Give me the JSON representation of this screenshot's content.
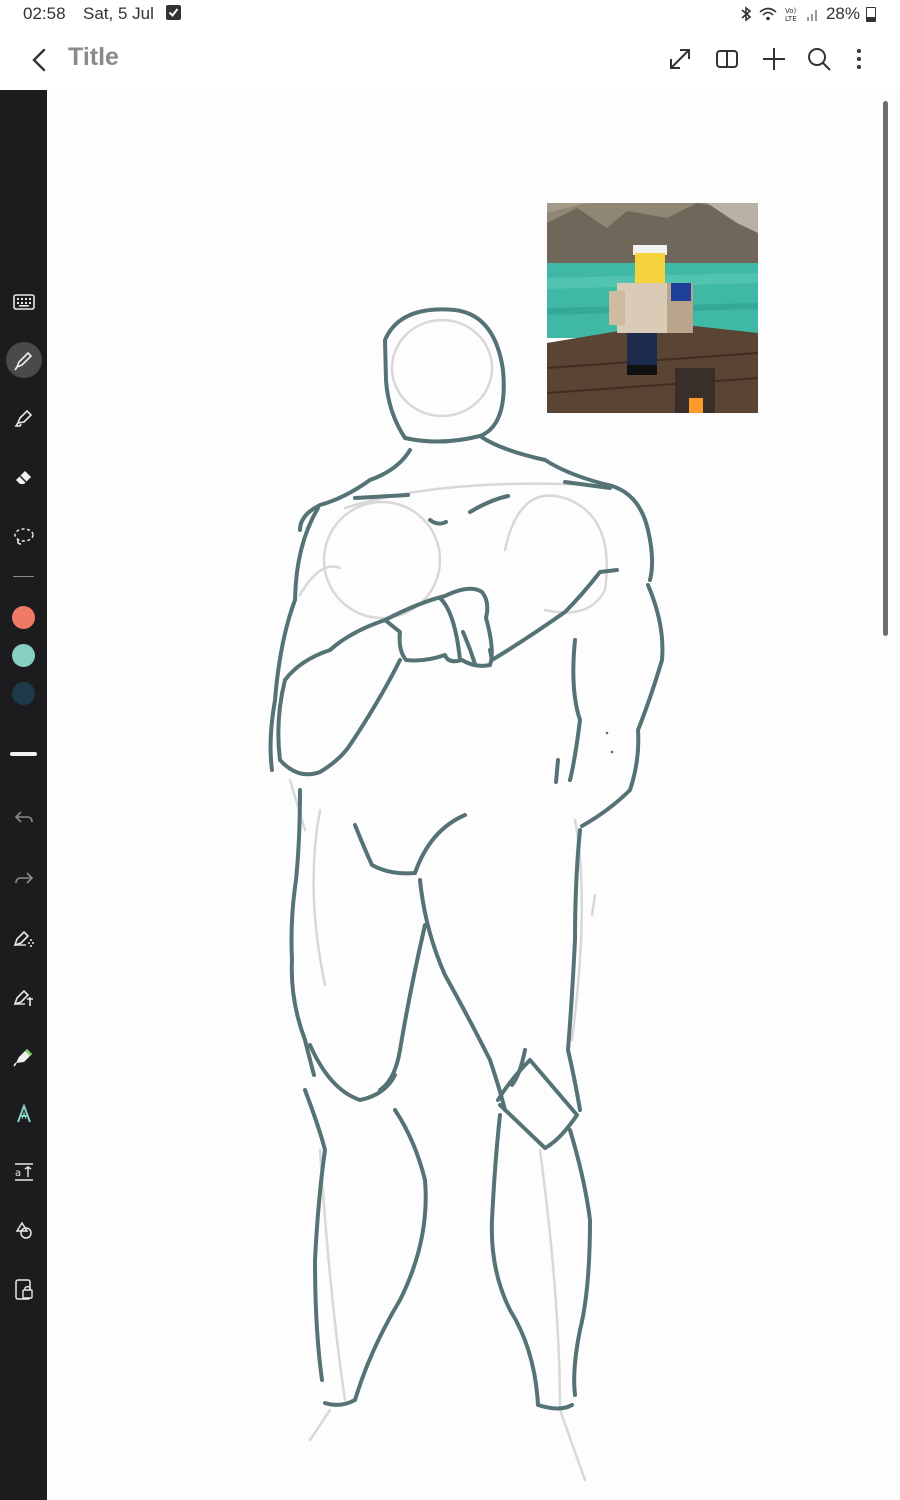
{
  "status_bar": {
    "time": "02:58",
    "date": "Sat, 5 Jul",
    "battery": "28%",
    "icons": [
      "checkbox-icon",
      "bluetooth-icon",
      "wifi-icon",
      "volte-icon",
      "signal-icon",
      "battery-icon"
    ]
  },
  "header": {
    "title": "Title",
    "icons": [
      "back-arrow-icon",
      "expand-icon",
      "book-icon",
      "plus-icon",
      "search-icon",
      "more-vertical-icon"
    ]
  },
  "toolbar": {
    "tools": [
      "keyboard-icon",
      "pen-icon",
      "highlighter-icon",
      "eraser-icon",
      "lasso-icon",
      "undo-icon",
      "redo-icon",
      "ai-pen-icon",
      "shape-pen-icon",
      "marker-icon",
      "text-style-icon",
      "text-size-icon",
      "shapes-icon",
      "lock-page-icon"
    ],
    "active_tool": "pen-icon",
    "swatches": [
      "#ee7a63",
      "#86cfc1",
      "#1c3a48"
    ]
  },
  "colors": {
    "sketch_stroke": "#557275",
    "sketch_guides": "#d8d8d8",
    "sidebar_bg": "#1c1c1e",
    "title_color": "#8b8b8b"
  }
}
